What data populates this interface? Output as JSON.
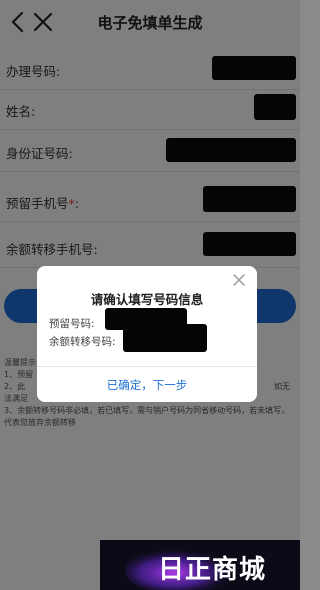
{
  "header": {
    "title": "电子免填单生成"
  },
  "form": {
    "fields": [
      {
        "label": "办理号码:",
        "required": false
      },
      {
        "label": "姓名:",
        "required": false
      },
      {
        "label": "身份证号码:",
        "required": false
      },
      {
        "label": "预留手机号",
        "required": true,
        "suffix": ":"
      },
      {
        "label": "余额转移手机号:",
        "required": false
      }
    ],
    "required_mark": "*"
  },
  "tips": {
    "line1": "温馨提示",
    "line2": "1、预留",
    "line3": "2、此",
    "line4": "法满足",
    "line5": "3、余额转移号码非必填，若已填写，需与销户号码为同省移动号码，若未填写，代表您放弃余额转移",
    "partial": "如无"
  },
  "modal": {
    "title": "请确认填写号码信息",
    "reserved_label": "预留号码:",
    "transfer_label": "余额转移号码:",
    "confirm_label": "已确定，下一步"
  },
  "watermark": {
    "text": "日正商城"
  },
  "colors": {
    "accent": "#1e6fd6",
    "required": "#e53935",
    "overlay": "rgba(0,0,0,0.5)"
  }
}
